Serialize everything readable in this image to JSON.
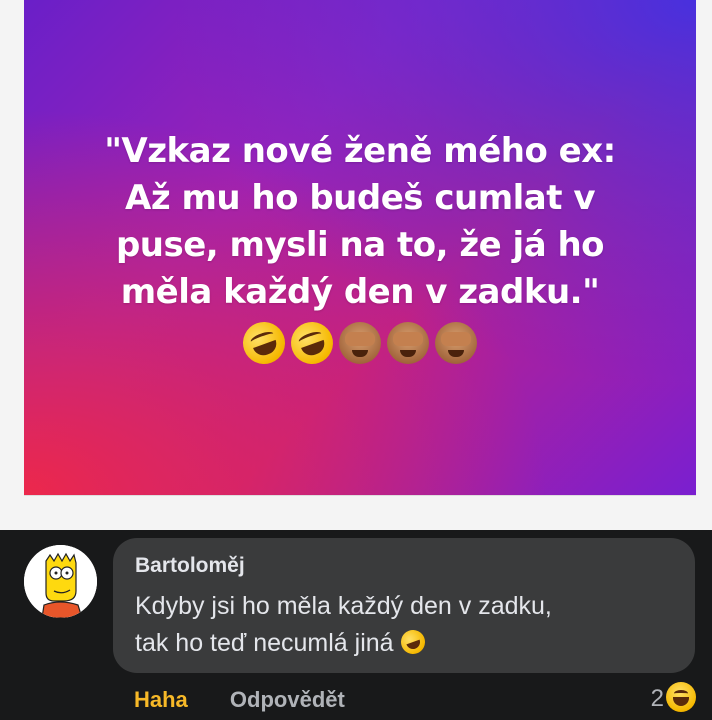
{
  "post": {
    "lines": [
      "\"Vzkaz nové ženě mého ex:",
      "Až mu ho budeš cumlat v",
      "puse, mysli na to, že já ho",
      "měla každý den v zadku.\""
    ],
    "emoji_icons": [
      "rolling-on-floor-laughing",
      "rolling-on-floor-laughing",
      "see-no-evil-monkey",
      "see-no-evil-monkey",
      "see-no-evil-monkey"
    ]
  },
  "comment": {
    "author": "Bartoloměj",
    "line1": "Kdyby jsi ho měla každý den v zadku,",
    "line2": "tak ho teď necumlá jiná",
    "inline_emoji": "rolling-on-floor-laughing",
    "actions": {
      "reaction_label": "Haha",
      "reply_label": "Odpovědět"
    },
    "reaction_count": "2",
    "reaction_icon": "grinning-squinting-face"
  },
  "colors": {
    "comment_bg": "#18191a",
    "bubble_bg": "#3a3b3c",
    "haha_color": "#f7b928"
  }
}
